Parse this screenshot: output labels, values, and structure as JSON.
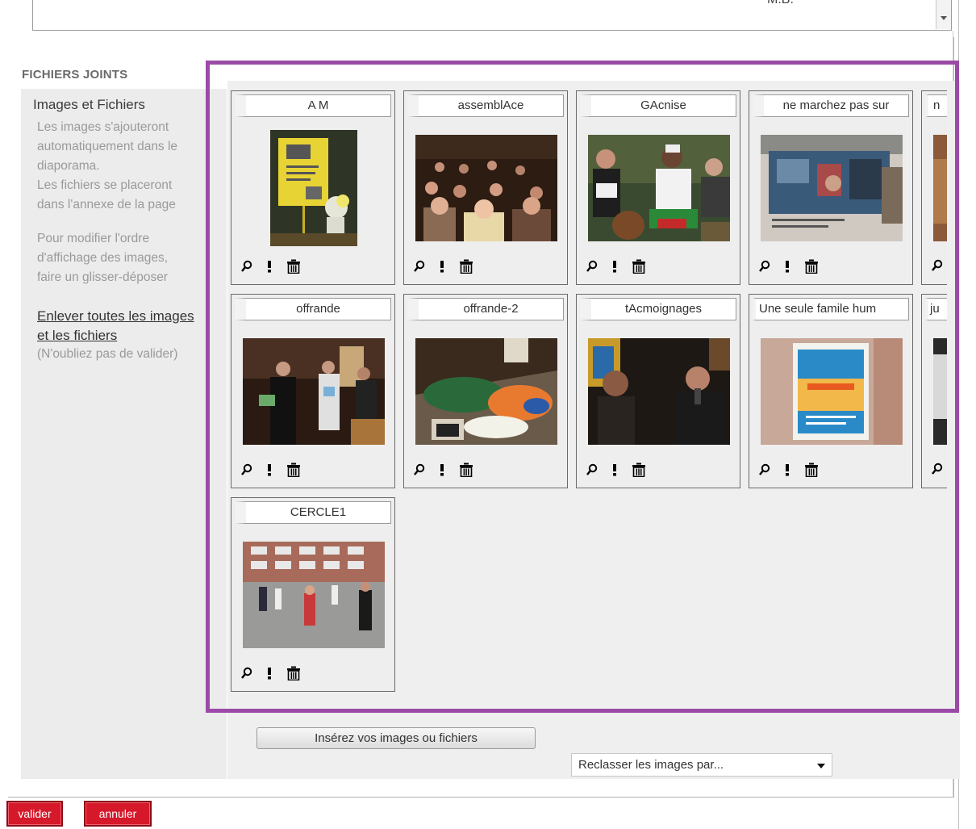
{
  "textarea": {
    "visible_text": "M.B."
  },
  "attachments": {
    "section_title": "FICHIERS JOINTS",
    "help": {
      "title": "Images et Fichiers",
      "lines_1": [
        "Les images s'ajouteront",
        "automatiquement dans le",
        "diaporama.",
        "Les fichiers se placeront",
        "dans l'annexe de la page"
      ],
      "lines_2": [
        "Pour modifier l'ordre",
        "d'affichage des images,",
        "faire un glisser-déposer"
      ],
      "remove_link": "Enlever toutes les images et les fichiers",
      "remove_note": "(N'oubliez pas de valider)"
    },
    "cards": [
      {
        "title": "A M",
        "thumb": "portrait-sign"
      },
      {
        "title": "assemblAce",
        "thumb": "church-crowd"
      },
      {
        "title": "GAcnise",
        "thumb": "drummers"
      },
      {
        "title": "ne marchez pas sur",
        "thumb": "poster-board"
      },
      {
        "title": "n",
        "thumb": "partial"
      },
      {
        "title": "offrande",
        "thumb": "procession"
      },
      {
        "title": "offrande-2",
        "thumb": "table-offering"
      },
      {
        "title": "tAcmoignages",
        "thumb": "speakers"
      },
      {
        "title": "Une seule famile hum",
        "thumb": "humanity-poster"
      },
      {
        "title": "ju",
        "thumb": "partial"
      },
      {
        "title": "CERCLE1",
        "thumb": "square-crowd"
      }
    ],
    "insert_button": "Insérez vos images ou fichiers",
    "sort_select": "Reclasser les images par..."
  },
  "footer": {
    "validate": "valider",
    "cancel": "annuler"
  },
  "icons": {
    "zoom": "magnifier-icon",
    "info": "exclamation-icon",
    "delete": "trash-icon"
  },
  "colors": {
    "highlight": "#9b4aa7",
    "button_red": "#d6192a"
  }
}
